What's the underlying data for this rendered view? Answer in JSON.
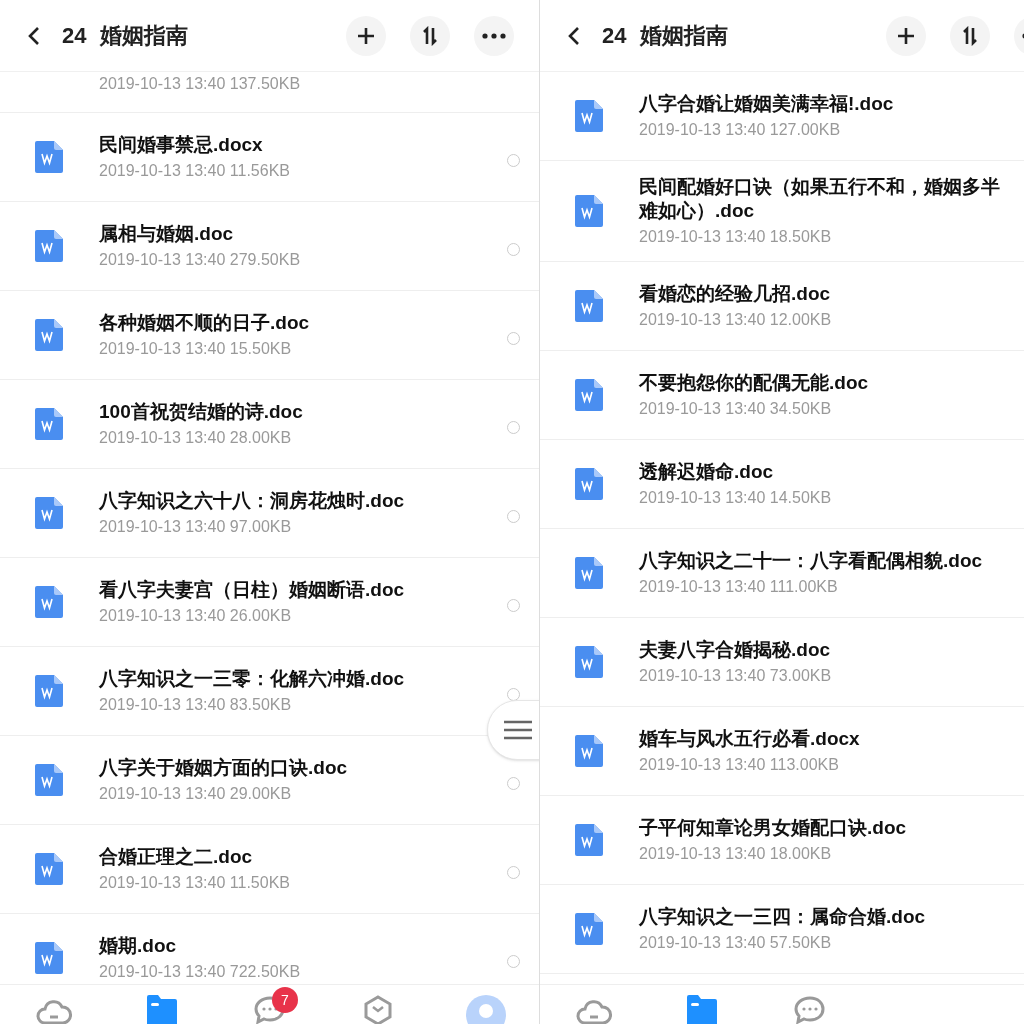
{
  "panels": [
    {
      "header": {
        "count": "24",
        "title": "婚姻指南"
      },
      "floating_button": {
        "kind": "menu"
      },
      "files": [
        {
          "kind": "scrolled",
          "meta": "2019-10-13  13:40  137.50KB"
        },
        {
          "kind": "doc",
          "name": "民间婚事禁忌.docx",
          "meta": "2019-10-13  13:40  11.56KB",
          "selected": false
        },
        {
          "kind": "doc",
          "name": "属相与婚姻.doc",
          "meta": "2019-10-13  13:40  279.50KB",
          "selected": false
        },
        {
          "kind": "doc",
          "name": "各种婚姻不顺的日子.doc",
          "meta": "2019-10-13  13:40  15.50KB",
          "selected": false
        },
        {
          "kind": "doc",
          "name": "100首祝贺结婚的诗.doc",
          "meta": "2019-10-13  13:40  28.00KB",
          "selected": false
        },
        {
          "kind": "doc",
          "name": "八字知识之六十八：洞房花烛时.doc",
          "meta": "2019-10-13  13:40  97.00KB",
          "selected": false
        },
        {
          "kind": "doc",
          "name": "看八字夫妻宫（日柱）婚姻断语.doc",
          "meta": "2019-10-13  13:40  26.00KB",
          "selected": false
        },
        {
          "kind": "doc",
          "name": "八字知识之一三零：化解六冲婚.doc",
          "meta": "2019-10-13  13:40  83.50KB",
          "selected": false
        },
        {
          "kind": "doc",
          "name": "八字关于婚姻方面的口诀.doc",
          "meta": "2019-10-13  13:40  29.00KB",
          "selected": false
        },
        {
          "kind": "doc",
          "name": "合婚正理之二.doc",
          "meta": "2019-10-13  13:40  11.50KB",
          "selected": false
        },
        {
          "kind": "doc",
          "name": "婚期.doc",
          "meta": "2019-10-13  13:40  722.50KB",
          "selected": false
        }
      ],
      "tabs": [
        {
          "kind": "cloud",
          "selected": false
        },
        {
          "kind": "files",
          "selected": true
        },
        {
          "kind": "chat",
          "selected": false,
          "badge": "7"
        },
        {
          "kind": "box",
          "selected": false
        },
        {
          "kind": "profile",
          "selected": false
        }
      ]
    },
    {
      "header": {
        "count": "24",
        "title": "婚姻指南"
      },
      "files": [
        {
          "kind": "doc",
          "name": "八字合婚让婚姻美满幸福!.doc",
          "meta": "2019-10-13  13:40  127.00KB"
        },
        {
          "kind": "doc",
          "name": "民间配婚好口诀（如果五行不和，婚姻多半难如心）.doc",
          "meta": "2019-10-13  13:40  18.50KB"
        },
        {
          "kind": "doc",
          "name": "看婚恋的经验几招.doc",
          "meta": "2019-10-13  13:40  12.00KB"
        },
        {
          "kind": "doc",
          "name": "不要抱怨你的配偶无能.doc",
          "meta": "2019-10-13  13:40  34.50KB"
        },
        {
          "kind": "doc",
          "name": "透解迟婚命.doc",
          "meta": "2019-10-13  13:40  14.50KB"
        },
        {
          "kind": "doc",
          "name": "八字知识之二十一：八字看配偶相貌.doc",
          "meta": "2019-10-13  13:40  111.00KB"
        },
        {
          "kind": "doc",
          "name": "夫妻八字合婚揭秘.doc",
          "meta": "2019-10-13  13:40  73.00KB"
        },
        {
          "kind": "doc",
          "name": "婚车与风水五行必看.docx",
          "meta": "2019-10-13  13:40  113.00KB"
        },
        {
          "kind": "doc",
          "name": "子平何知章论男女婚配口诀.doc",
          "meta": "2019-10-13  13:40  18.00KB"
        },
        {
          "kind": "doc",
          "name": "八字知识之一三四：属命合婚.doc",
          "meta": "2019-10-13  13:40  57.50KB"
        }
      ],
      "tabs": [
        {
          "kind": "cloud",
          "selected": false
        },
        {
          "kind": "files",
          "selected": true
        },
        {
          "kind": "chat",
          "selected": false
        }
      ]
    }
  ]
}
